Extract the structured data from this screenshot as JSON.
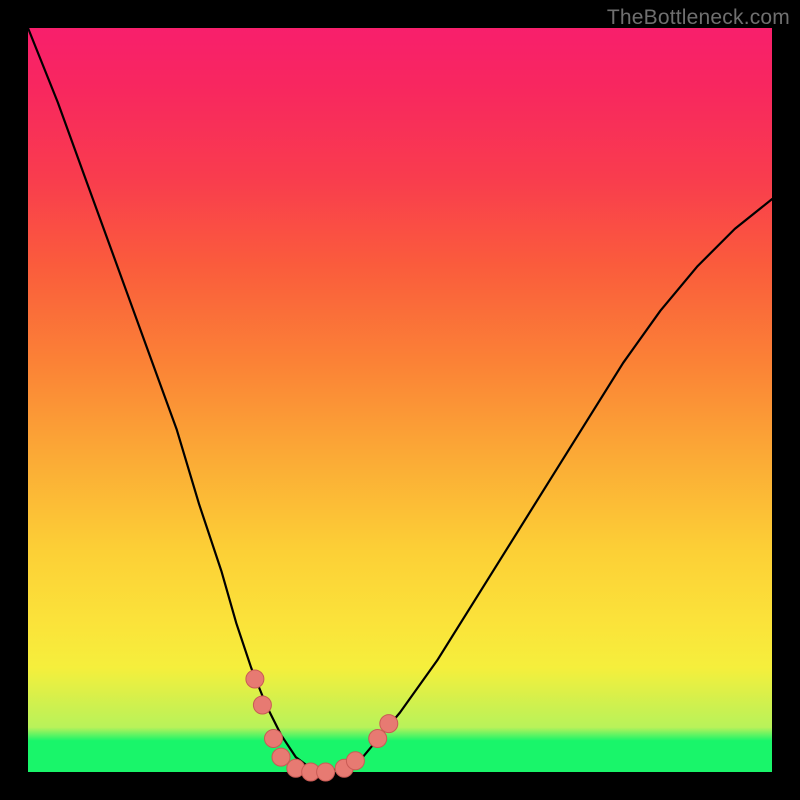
{
  "watermark": "TheBottleneck.com",
  "colors": {
    "frame": "#000000",
    "gradient_top": "#f81f6c",
    "gradient_bottom": "#19f56a",
    "curve": "#000000",
    "marker_fill": "#e77a72",
    "marker_stroke": "#c95b55"
  },
  "chart_data": {
    "type": "line",
    "title": "",
    "xlabel": "",
    "ylabel": "",
    "xlim": [
      0,
      100
    ],
    "ylim": [
      0,
      100
    ],
    "grid": false,
    "legend": false,
    "series": [
      {
        "name": "bottleneck-curve",
        "x": [
          0,
          4,
          8,
          12,
          16,
          20,
          23,
          26,
          28,
          30,
          32,
          34,
          36,
          38,
          40,
          42,
          45,
          50,
          55,
          60,
          65,
          70,
          75,
          80,
          85,
          90,
          95,
          100
        ],
        "values": [
          100,
          90,
          79,
          68,
          57,
          46,
          36,
          27,
          20,
          14,
          9,
          5,
          2,
          0.5,
          0,
          0.5,
          2,
          8,
          15,
          23,
          31,
          39,
          47,
          55,
          62,
          68,
          73,
          77
        ]
      }
    ],
    "markers": [
      {
        "x": 30.5,
        "y": 12.5
      },
      {
        "x": 31.5,
        "y": 9.0
      },
      {
        "x": 33.0,
        "y": 4.5
      },
      {
        "x": 34.0,
        "y": 2.0
      },
      {
        "x": 36.0,
        "y": 0.5
      },
      {
        "x": 38.0,
        "y": 0.0
      },
      {
        "x": 40.0,
        "y": 0.0
      },
      {
        "x": 42.5,
        "y": 0.5
      },
      {
        "x": 44.0,
        "y": 1.5
      },
      {
        "x": 47.0,
        "y": 4.5
      },
      {
        "x": 48.5,
        "y": 6.5
      }
    ]
  }
}
